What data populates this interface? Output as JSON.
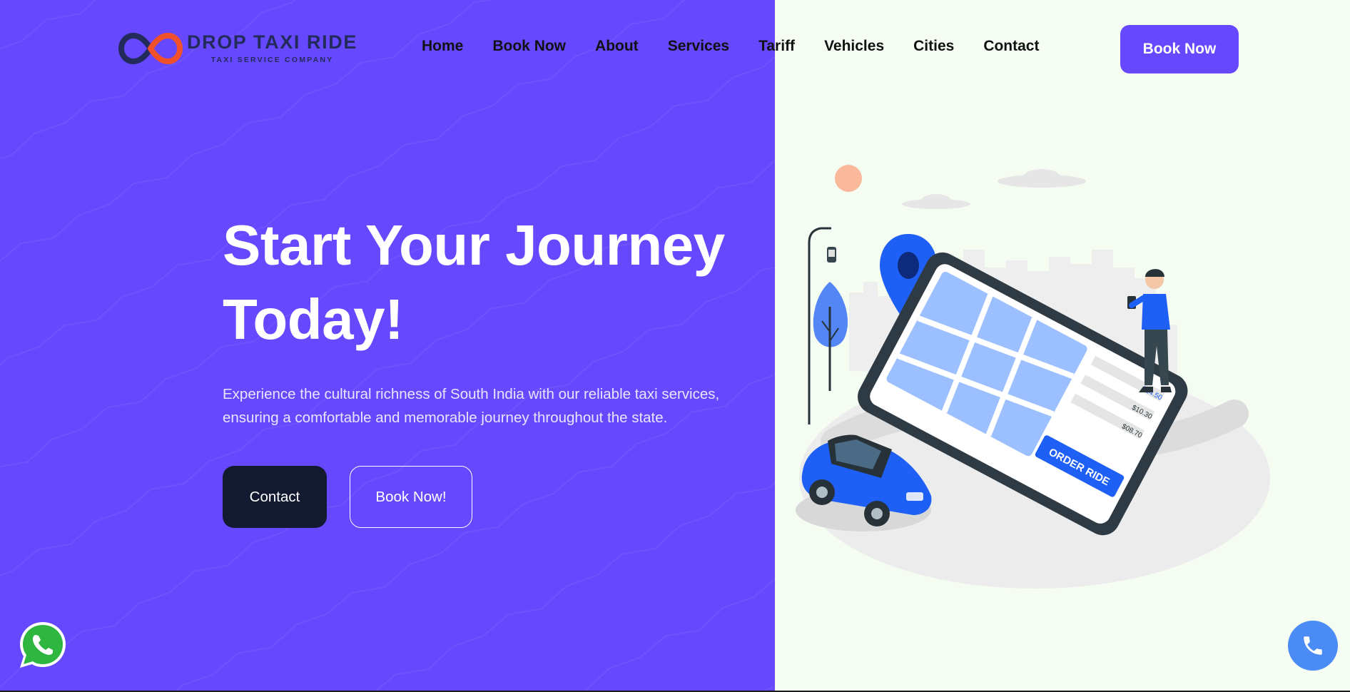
{
  "brand": {
    "name": "DROP TAXI RIDE",
    "tagline": "TAXI SERVICE COMPANY"
  },
  "nav": {
    "items": [
      {
        "label": "Home"
      },
      {
        "label": "Book Now"
      },
      {
        "label": "About"
      },
      {
        "label": "Services"
      },
      {
        "label": "Tariff"
      },
      {
        "label": "Vehicles"
      },
      {
        "label": "Cities"
      },
      {
        "label": "Contact"
      }
    ],
    "cta_label": "Book Now"
  },
  "hero": {
    "title_line1": "Start Your Journey",
    "title_line2": "Today!",
    "description_line1": "Experience the cultural richness of South India with our reliable taxi services,",
    "description_line2": "ensuring a comfortable and memorable journey throughout the state.",
    "contact_label": "Contact",
    "book_label": "Book Now!"
  },
  "illustration": {
    "order_button": "ORDER RIDE",
    "prices": [
      "$14.50",
      "$10.30",
      "$08.70"
    ]
  },
  "icons": {
    "whatsapp": "whatsapp-icon",
    "call": "phone-icon",
    "logo": "infinity-logo-icon"
  },
  "colors": {
    "primary": "#6648fe",
    "dark": "#121a30",
    "illustration_blue": "#1e5ff5",
    "background_right": "#f5fdf3",
    "logo_red": "#f0512b",
    "logo_navy": "#232a5c",
    "whatsapp_green": "#2fb640",
    "call_blue": "#4a8bf5"
  }
}
